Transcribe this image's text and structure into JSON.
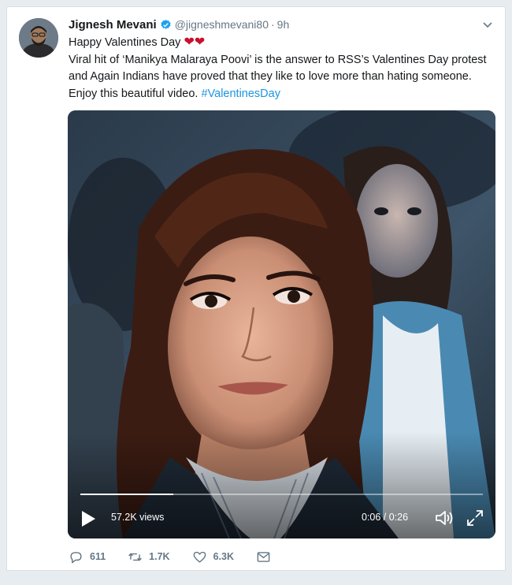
{
  "tweet": {
    "display_name": "Jignesh Mevani",
    "handle": "@jigneshmevani80",
    "separator": "·",
    "time": "9h",
    "verified_icon": "verified-badge-icon",
    "menu_icon": "chevron-down-icon",
    "text_line1": "Happy Valentines Day",
    "hearts": "❤❤",
    "text_line2": "Viral hit of ‘Manikya Malaraya Poovi’ is the answer to RSS’s Valentines Day protest",
    "text_line3": "and Again Indians have proved that they like to love more than hating someone.",
    "text_line4_plain": "Enjoy this beautiful video.",
    "hashtag": "#ValentinesDay"
  },
  "video": {
    "views": "57.2K views",
    "timecode": "0:06 / 0:26",
    "progress": 0.23,
    "play_icon": "play-icon",
    "volume_icon": "volume-icon",
    "fullscreen_icon": "fullscreen-icon"
  },
  "actions": {
    "reply_count": "611",
    "retweet_count": "1.7K",
    "like_count": "6.3K",
    "icons": [
      "reply-icon",
      "retweet-icon",
      "like-icon",
      "direct-message-icon"
    ]
  },
  "colors": {
    "background": "#e6ecf0",
    "link": "#1b95e0",
    "heart": "#c8102e",
    "muted": "#657786",
    "verified": "#1da1f2"
  }
}
